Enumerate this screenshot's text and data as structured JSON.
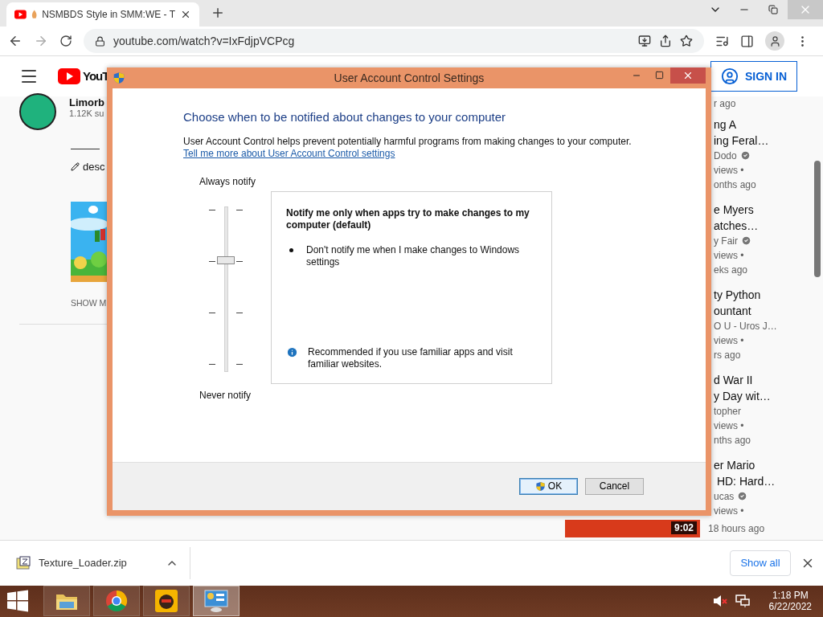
{
  "browser": {
    "tab": {
      "title": "NSMBDS Style in SMM:WE - T",
      "selected": true
    },
    "forward": {
      "disabled": true
    },
    "address": "youtube.com/watch?v=IxFdjpVCPcg"
  },
  "youtube": {
    "logo_text": "YouT",
    "sign_in": "SIGN IN",
    "channel": {
      "name": "Limorb",
      "subscribers": "1.12K su"
    },
    "rule_text": "———",
    "description": "desc",
    "show_more": "SHOW M",
    "first_age": "r ago",
    "suggestions": [
      {
        "title_lines": [
          "ng A",
          "ing Feral…"
        ],
        "channel": "Dodo",
        "verified": true,
        "views": "views •",
        "age": "onths ago"
      },
      {
        "title_lines": [
          "e Myers",
          "atches…"
        ],
        "channel": "y Fair",
        "verified": true,
        "views": "views •",
        "age": "eks ago"
      },
      {
        "title_lines": [
          "ty Python",
          "ountant"
        ],
        "channel": "O U - Uros J…",
        "verified": false,
        "views": "views •",
        "age": "rs ago"
      },
      {
        "title_lines": [
          "d War II",
          "y Day wit…"
        ],
        "channel": "topher",
        "verified": false,
        "views": "views •",
        "age": "nths ago"
      },
      {
        "title_lines": [
          "er Mario",
          " HD: Hard…"
        ],
        "channel": "ucas",
        "verified": true,
        "views": "views •"
      }
    ],
    "bottom_video": {
      "duration": "9:02",
      "age": "18 hours ago"
    }
  },
  "dialog": {
    "title": "User Account Control Settings",
    "heading": "Choose when to be notified about changes to your computer",
    "description": "User Account Control helps prevent potentially harmful programs from making changes to your computer.",
    "link": "Tell me more about User Account Control settings",
    "top_label": "Always notify",
    "bottom_label": "Never notify",
    "slider": {
      "level": 0.67
    },
    "panel": {
      "title": "Notify me only when apps try to make changes to my computer (default)",
      "bullets": [
        "Don't notify me when I make changes to Windows settings"
      ],
      "note": "Recommended if you use familiar apps and visit familiar websites."
    },
    "buttons": [
      {
        "label": "OK",
        "shield": true,
        "default": true
      },
      {
        "label": "Cancel",
        "shield": false,
        "default": false
      }
    ]
  },
  "downloads": {
    "file": "Texture_Loader.zip",
    "show_all": "Show all"
  },
  "taskbar": {
    "apps": [
      {
        "kind": "explorer",
        "selected": false
      },
      {
        "kind": "browser",
        "selected": false
      },
      {
        "kind": "game",
        "selected": false
      },
      {
        "kind": "panel",
        "selected": true
      }
    ],
    "muted": true,
    "time": "1:18 PM",
    "date": "6/22/2022"
  }
}
